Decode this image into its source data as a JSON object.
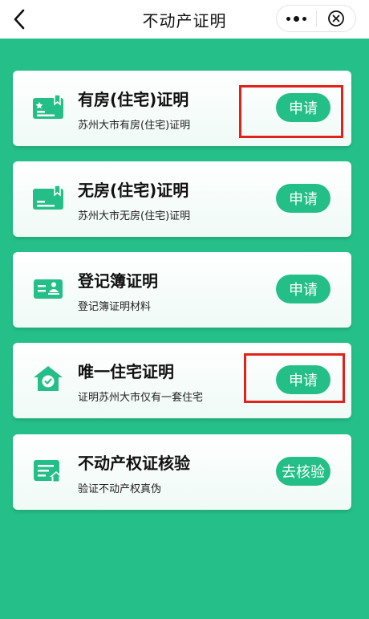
{
  "header": {
    "title": "不动产证明"
  },
  "cards": [
    {
      "title": "有房(住宅)证明",
      "subtitle": "苏州大市有房(住宅)证明",
      "action": "申请",
      "icon": "house-certificate-star-icon"
    },
    {
      "title": "无房(住宅)证明",
      "subtitle": "苏州大市无房(住宅)证明",
      "action": "申请",
      "icon": "house-certificate-icon"
    },
    {
      "title": "登记簿证明",
      "subtitle": "登记簿证明材料",
      "action": "申请",
      "icon": "register-book-icon"
    },
    {
      "title": "唯一住宅证明",
      "subtitle": "证明苏州大市仅有一套住宅",
      "action": "申请",
      "icon": "house-check-icon"
    },
    {
      "title": "不动产权证核验",
      "subtitle": "验证不动产权真伪",
      "action": "去核验",
      "icon": "property-verify-icon"
    }
  ],
  "colors": {
    "background": "#25c08a",
    "button": "#24bf88",
    "highlight": "#e0221a"
  }
}
